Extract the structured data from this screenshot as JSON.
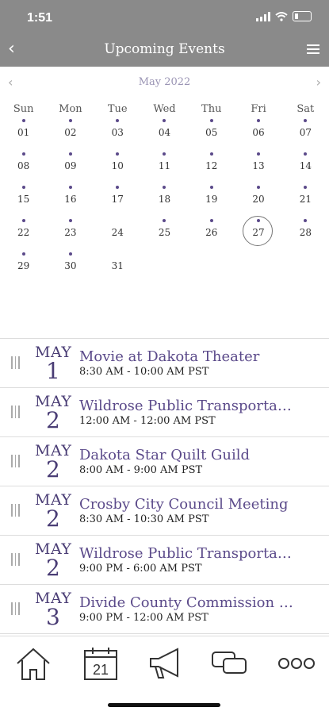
{
  "status": {
    "time": "1:51"
  },
  "navbar": {
    "title": "Upcoming Events"
  },
  "calendar": {
    "month": "May 2022",
    "weekdays": [
      "Sun",
      "Mon",
      "Tue",
      "Wed",
      "Thu",
      "Fri",
      "Sat"
    ],
    "weeks": [
      [
        {
          "d": "01",
          "dot": true
        },
        {
          "d": "02",
          "dot": true
        },
        {
          "d": "03",
          "dot": true
        },
        {
          "d": "04",
          "dot": true
        },
        {
          "d": "05",
          "dot": true
        },
        {
          "d": "06",
          "dot": true
        },
        {
          "d": "07",
          "dot": true
        }
      ],
      [
        {
          "d": "08",
          "dot": true
        },
        {
          "d": "09",
          "dot": true
        },
        {
          "d": "10",
          "dot": true
        },
        {
          "d": "11",
          "dot": true
        },
        {
          "d": "12",
          "dot": true
        },
        {
          "d": "13",
          "dot": true
        },
        {
          "d": "14",
          "dot": true
        }
      ],
      [
        {
          "d": "15",
          "dot": true
        },
        {
          "d": "16",
          "dot": true
        },
        {
          "d": "17",
          "dot": true
        },
        {
          "d": "18",
          "dot": true
        },
        {
          "d": "19",
          "dot": true
        },
        {
          "d": "20",
          "dot": true
        },
        {
          "d": "21",
          "dot": true
        }
      ],
      [
        {
          "d": "22",
          "dot": true
        },
        {
          "d": "23",
          "dot": true
        },
        {
          "d": "24",
          "dot": false
        },
        {
          "d": "25",
          "dot": true
        },
        {
          "d": "26",
          "dot": true
        },
        {
          "d": "27",
          "dot": true,
          "selected": true
        },
        {
          "d": "28",
          "dot": true
        }
      ],
      [
        {
          "d": "29",
          "dot": true
        },
        {
          "d": "30",
          "dot": true
        },
        {
          "d": "31",
          "dot": false
        }
      ]
    ]
  },
  "events": [
    {
      "month": "MAY",
      "day": "1",
      "name": "Movie at Dakota Theater",
      "time": "8:30 AM - 10:00 AM PST"
    },
    {
      "month": "MAY",
      "day": "2",
      "name": "Wildrose Public Transportation",
      "time": "12:00 AM - 12:00 AM PST"
    },
    {
      "month": "MAY",
      "day": "2",
      "name": "Dakota Star Quilt Guild",
      "time": "8:00 AM - 9:00 AM PST"
    },
    {
      "month": "MAY",
      "day": "2",
      "name": "Crosby City Council Meeting",
      "time": "8:30 AM - 10:30 AM PST"
    },
    {
      "month": "MAY",
      "day": "2",
      "name": "Wildrose Public Transportation",
      "time": "9:00 PM - 6:00 AM PST"
    },
    {
      "month": "MAY",
      "day": "3",
      "name": "Divide County Commission Meeting",
      "time": "9:00 PM - 12:00 AM PST"
    }
  ],
  "tabbar": {
    "calendar_day": "21",
    "icons": [
      "home-icon",
      "calendar-icon",
      "megaphone-icon",
      "chat-icon",
      "more-icon"
    ]
  },
  "colors": {
    "header": "#8a8a8a",
    "accent": "#5b4a8a"
  }
}
